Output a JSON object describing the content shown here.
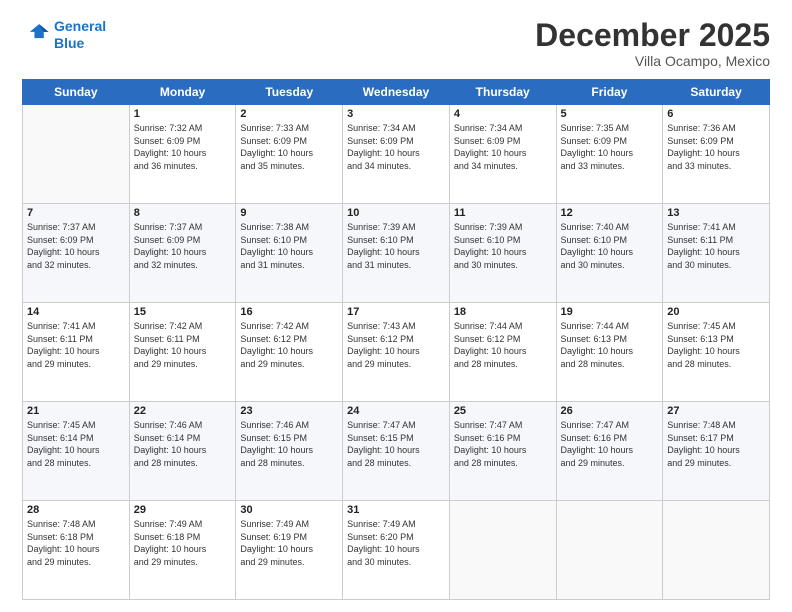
{
  "logo": {
    "line1": "General",
    "line2": "Blue"
  },
  "header": {
    "month_year": "December 2025",
    "location": "Villa Ocampo, Mexico"
  },
  "days_of_week": [
    "Sunday",
    "Monday",
    "Tuesday",
    "Wednesday",
    "Thursday",
    "Friday",
    "Saturday"
  ],
  "weeks": [
    [
      {
        "day": "",
        "info": ""
      },
      {
        "day": "1",
        "info": "Sunrise: 7:32 AM\nSunset: 6:09 PM\nDaylight: 10 hours\nand 36 minutes."
      },
      {
        "day": "2",
        "info": "Sunrise: 7:33 AM\nSunset: 6:09 PM\nDaylight: 10 hours\nand 35 minutes."
      },
      {
        "day": "3",
        "info": "Sunrise: 7:34 AM\nSunset: 6:09 PM\nDaylight: 10 hours\nand 34 minutes."
      },
      {
        "day": "4",
        "info": "Sunrise: 7:34 AM\nSunset: 6:09 PM\nDaylight: 10 hours\nand 34 minutes."
      },
      {
        "day": "5",
        "info": "Sunrise: 7:35 AM\nSunset: 6:09 PM\nDaylight: 10 hours\nand 33 minutes."
      },
      {
        "day": "6",
        "info": "Sunrise: 7:36 AM\nSunset: 6:09 PM\nDaylight: 10 hours\nand 33 minutes."
      }
    ],
    [
      {
        "day": "7",
        "info": "Sunrise: 7:37 AM\nSunset: 6:09 PM\nDaylight: 10 hours\nand 32 minutes."
      },
      {
        "day": "8",
        "info": "Sunrise: 7:37 AM\nSunset: 6:09 PM\nDaylight: 10 hours\nand 32 minutes."
      },
      {
        "day": "9",
        "info": "Sunrise: 7:38 AM\nSunset: 6:10 PM\nDaylight: 10 hours\nand 31 minutes."
      },
      {
        "day": "10",
        "info": "Sunrise: 7:39 AM\nSunset: 6:10 PM\nDaylight: 10 hours\nand 31 minutes."
      },
      {
        "day": "11",
        "info": "Sunrise: 7:39 AM\nSunset: 6:10 PM\nDaylight: 10 hours\nand 30 minutes."
      },
      {
        "day": "12",
        "info": "Sunrise: 7:40 AM\nSunset: 6:10 PM\nDaylight: 10 hours\nand 30 minutes."
      },
      {
        "day": "13",
        "info": "Sunrise: 7:41 AM\nSunset: 6:11 PM\nDaylight: 10 hours\nand 30 minutes."
      }
    ],
    [
      {
        "day": "14",
        "info": "Sunrise: 7:41 AM\nSunset: 6:11 PM\nDaylight: 10 hours\nand 29 minutes."
      },
      {
        "day": "15",
        "info": "Sunrise: 7:42 AM\nSunset: 6:11 PM\nDaylight: 10 hours\nand 29 minutes."
      },
      {
        "day": "16",
        "info": "Sunrise: 7:42 AM\nSunset: 6:12 PM\nDaylight: 10 hours\nand 29 minutes."
      },
      {
        "day": "17",
        "info": "Sunrise: 7:43 AM\nSunset: 6:12 PM\nDaylight: 10 hours\nand 29 minutes."
      },
      {
        "day": "18",
        "info": "Sunrise: 7:44 AM\nSunset: 6:12 PM\nDaylight: 10 hours\nand 28 minutes."
      },
      {
        "day": "19",
        "info": "Sunrise: 7:44 AM\nSunset: 6:13 PM\nDaylight: 10 hours\nand 28 minutes."
      },
      {
        "day": "20",
        "info": "Sunrise: 7:45 AM\nSunset: 6:13 PM\nDaylight: 10 hours\nand 28 minutes."
      }
    ],
    [
      {
        "day": "21",
        "info": "Sunrise: 7:45 AM\nSunset: 6:14 PM\nDaylight: 10 hours\nand 28 minutes."
      },
      {
        "day": "22",
        "info": "Sunrise: 7:46 AM\nSunset: 6:14 PM\nDaylight: 10 hours\nand 28 minutes."
      },
      {
        "day": "23",
        "info": "Sunrise: 7:46 AM\nSunset: 6:15 PM\nDaylight: 10 hours\nand 28 minutes."
      },
      {
        "day": "24",
        "info": "Sunrise: 7:47 AM\nSunset: 6:15 PM\nDaylight: 10 hours\nand 28 minutes."
      },
      {
        "day": "25",
        "info": "Sunrise: 7:47 AM\nSunset: 6:16 PM\nDaylight: 10 hours\nand 28 minutes."
      },
      {
        "day": "26",
        "info": "Sunrise: 7:47 AM\nSunset: 6:16 PM\nDaylight: 10 hours\nand 29 minutes."
      },
      {
        "day": "27",
        "info": "Sunrise: 7:48 AM\nSunset: 6:17 PM\nDaylight: 10 hours\nand 29 minutes."
      }
    ],
    [
      {
        "day": "28",
        "info": "Sunrise: 7:48 AM\nSunset: 6:18 PM\nDaylight: 10 hours\nand 29 minutes."
      },
      {
        "day": "29",
        "info": "Sunrise: 7:49 AM\nSunset: 6:18 PM\nDaylight: 10 hours\nand 29 minutes."
      },
      {
        "day": "30",
        "info": "Sunrise: 7:49 AM\nSunset: 6:19 PM\nDaylight: 10 hours\nand 29 minutes."
      },
      {
        "day": "31",
        "info": "Sunrise: 7:49 AM\nSunset: 6:20 PM\nDaylight: 10 hours\nand 30 minutes."
      },
      {
        "day": "",
        "info": ""
      },
      {
        "day": "",
        "info": ""
      },
      {
        "day": "",
        "info": ""
      }
    ]
  ]
}
